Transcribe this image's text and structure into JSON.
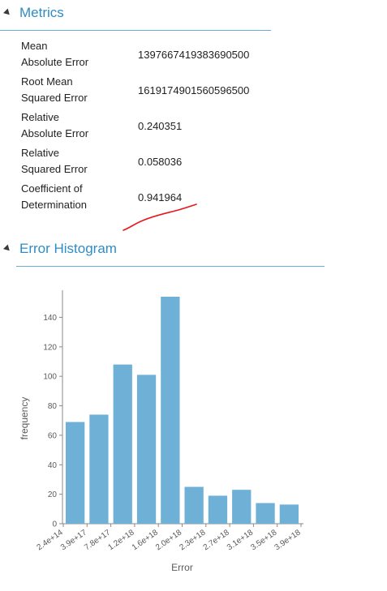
{
  "metrics": {
    "title": "Metrics",
    "rows": [
      {
        "label_line1": "Mean",
        "label_line2": "Absolute Error",
        "value": "1397667419383690500"
      },
      {
        "label_line1": "Root Mean",
        "label_line2": "Squared Error",
        "value": "1619174901560596500"
      },
      {
        "label_line1": "Relative",
        "label_line2": "Absolute Error",
        "value": "0.240351"
      },
      {
        "label_line1": "Relative",
        "label_line2": "Squared Error",
        "value": "0.058036"
      },
      {
        "label_line1": "Coefficient of",
        "label_line2": "Determination",
        "value": "0.941964"
      }
    ]
  },
  "histogram": {
    "title": "Error Histogram"
  },
  "colors": {
    "accent": "#2f8cc4",
    "rule": "#6aaed6",
    "bar": "#6fb1d6",
    "annotation": "#e8161c"
  },
  "chart_data": {
    "type": "bar",
    "categories": [
      "2.4e+14",
      "3.9e+17",
      "7.8e+17",
      "1.2e+18",
      "1.6e+18",
      "2.0e+18",
      "2.3e+18",
      "2.7e+18",
      "3.1e+18",
      "3.5e+18",
      "3.9e+18"
    ],
    "values": [
      69,
      74,
      108,
      101,
      154,
      25,
      19,
      23,
      14,
      13
    ],
    "xlabel": "Error",
    "ylabel": "frequency",
    "yticks": [
      0,
      20,
      40,
      60,
      80,
      100,
      120,
      140
    ],
    "ylim": [
      0,
      154
    ],
    "grid": false
  }
}
